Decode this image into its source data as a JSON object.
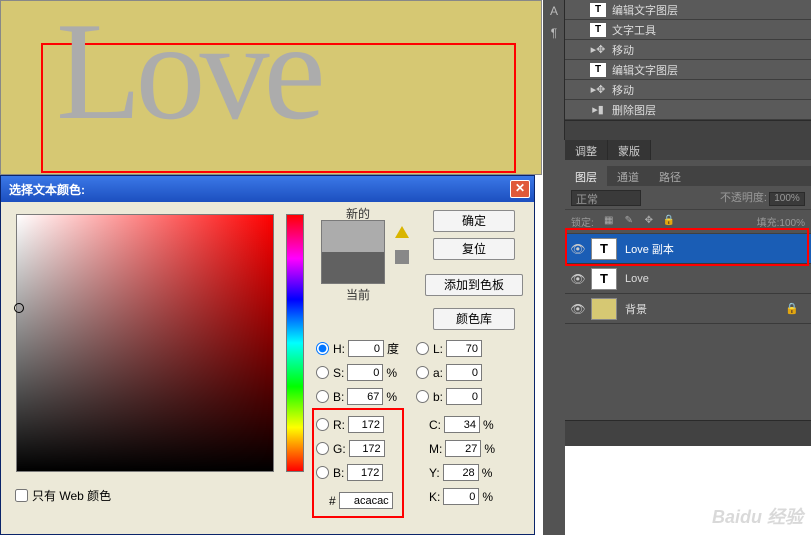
{
  "canvas": {
    "text": "Love"
  },
  "history": {
    "items": [
      {
        "icon": "T",
        "label": "编辑文字图层"
      },
      {
        "icon": "T",
        "label": "文字工具"
      },
      {
        "icon": "→",
        "label": "移动"
      },
      {
        "icon": "T",
        "label": "编辑文字图层"
      },
      {
        "icon": "→",
        "label": "移动"
      },
      {
        "icon": "▦",
        "label": "删除图层"
      }
    ]
  },
  "tabs1": {
    "a": "调整",
    "b": "蒙版"
  },
  "tabs2": {
    "a": "图层",
    "b": "通道",
    "c": "路径"
  },
  "layerOpts": {
    "blend": "正常",
    "opacityLabel": "不透明度:",
    "opacityVal": "100%",
    "lockLabel": "锁定:",
    "fillLabel": "填充:",
    "fillVal": "100%"
  },
  "layers": {
    "a": "Love 副本",
    "b": "Love",
    "c": "背景"
  },
  "dialog": {
    "title": "选择文本颜色:",
    "newLabel": "新的",
    "currentLabel": "当前",
    "ok": "确定",
    "reset": "复位",
    "addSwatch": "添加到色板",
    "colorLib": "颜色库",
    "webOnly": "只有 Web 颜色",
    "H": {
      "lbl": "H:",
      "val": "0",
      "unit": "度"
    },
    "S": {
      "lbl": "S:",
      "val": "0",
      "unit": "%"
    },
    "Bv": {
      "lbl": "B:",
      "val": "67",
      "unit": "%"
    },
    "R": {
      "lbl": "R:",
      "val": "172"
    },
    "G": {
      "lbl": "G:",
      "val": "172"
    },
    "B2": {
      "lbl": "B:",
      "val": "172"
    },
    "L": {
      "lbl": "L:",
      "val": "70"
    },
    "a": {
      "lbl": "a:",
      "val": "0"
    },
    "b": {
      "lbl": "b:",
      "val": "0"
    },
    "C": {
      "lbl": "C:",
      "val": "34",
      "unit": "%"
    },
    "M": {
      "lbl": "M:",
      "val": "27",
      "unit": "%"
    },
    "Y": {
      "lbl": "Y:",
      "val": "28",
      "unit": "%"
    },
    "K": {
      "lbl": "K:",
      "val": "0",
      "unit": "%"
    },
    "hex": {
      "lbl": "#",
      "val": "acacac"
    }
  },
  "watermark": "Baidu 经验"
}
